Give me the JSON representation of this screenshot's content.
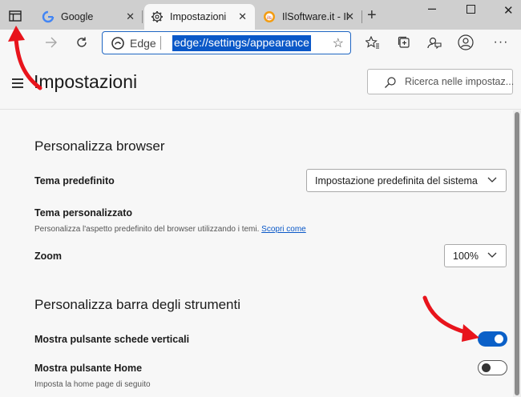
{
  "tabs": [
    {
      "label": "Google",
      "icon": "google-icon",
      "active": false
    },
    {
      "label": "Impostazioni",
      "icon": "gear-icon",
      "active": true
    },
    {
      "label": "IlSoftware.it - Il s",
      "icon": "ilsoftware-icon",
      "active": false
    }
  ],
  "omnibox": {
    "brand": "Edge",
    "url": "edge://settings/appearance"
  },
  "settings": {
    "title": "Impostazioni",
    "search_placeholder": "Ricerca nelle impostaz..."
  },
  "section_browser": {
    "title": "Personalizza browser",
    "theme_label": "Tema predefinito",
    "theme_value": "Impostazione predefinita del sistema",
    "custom_theme_label": "Tema personalizzato",
    "custom_theme_desc": "Personalizza l'aspetto predefinito del browser utilizzando i temi.",
    "custom_theme_link": "Scopri come",
    "zoom_label": "Zoom",
    "zoom_value": "100%"
  },
  "section_toolbar": {
    "title": "Personalizza barra degli strumenti",
    "vertical_tabs_label": "Mostra pulsante schede verticali",
    "vertical_tabs_on": true,
    "home_label": "Mostra pulsante Home",
    "home_desc": "Imposta la home page di seguito",
    "home_on": false
  },
  "colors": {
    "accent": "#0a60c8",
    "annotation": "#e8141c"
  }
}
